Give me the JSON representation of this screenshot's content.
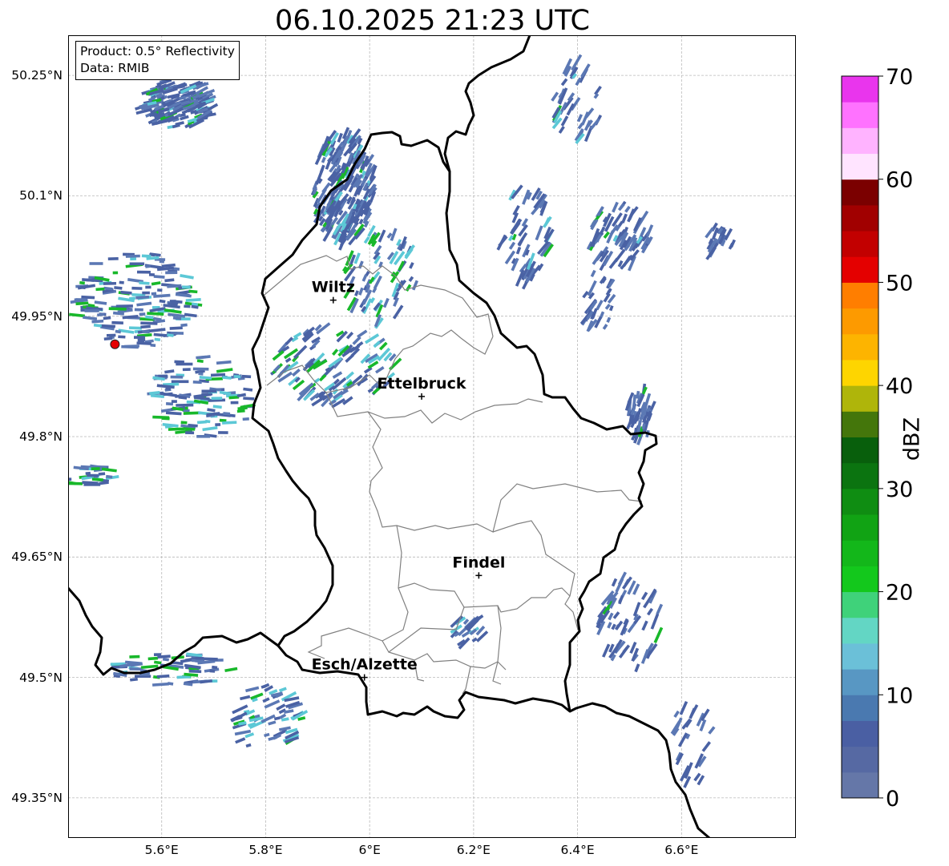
{
  "title": "06.10.2025 21:23 UTC",
  "info": {
    "product": "Product: 0.5° Reflectivity",
    "data": "Data: RMIB"
  },
  "map": {
    "lon_range": [
      5.42,
      6.82
    ],
    "lat_range": [
      49.3,
      50.3
    ],
    "gridlines": true,
    "lat_ticks": [
      {
        "value": 50.25,
        "label": "50.25°N"
      },
      {
        "value": 50.1,
        "label": "50.1°N"
      },
      {
        "value": 49.95,
        "label": "49.95°N"
      },
      {
        "value": 49.8,
        "label": "49.8°N"
      },
      {
        "value": 49.65,
        "label": "49.65°N"
      },
      {
        "value": 49.5,
        "label": "49.5°N"
      },
      {
        "value": 49.35,
        "label": "49.35°N"
      }
    ],
    "lon_ticks": [
      {
        "value": 5.6,
        "label": "5.6°E"
      },
      {
        "value": 5.8,
        "label": "5.8°E"
      },
      {
        "value": 6.0,
        "label": "6°E"
      },
      {
        "value": 6.2,
        "label": "6.2°E"
      },
      {
        "value": 6.4,
        "label": "6.4°E"
      },
      {
        "value": 6.6,
        "label": "6.6°E"
      }
    ],
    "cities": [
      {
        "name": "Wiltz",
        "lon": 5.93,
        "lat": 49.97
      },
      {
        "name": "Ettelbruck",
        "lon": 6.1,
        "lat": 49.85
      },
      {
        "name": "Findel",
        "lon": 6.21,
        "lat": 49.627
      },
      {
        "name": "Esch/Alzette",
        "lon": 5.99,
        "lat": 49.5
      }
    ],
    "radar_site": {
      "lon": 5.51,
      "lat": 49.915,
      "color": "#e60000"
    },
    "border_color": "#000000",
    "canton_color": "#808080"
  },
  "colorbar": {
    "label": "dBZ",
    "min": 0,
    "max": 70,
    "step": 2.5,
    "tick_labels": [
      "0",
      "10",
      "20",
      "30",
      "40",
      "50",
      "60",
      "70"
    ],
    "colors": [
      "#6577a8",
      "#5669a3",
      "#4a5fa3",
      "#4a79b0",
      "#5897c3",
      "#6bc0d8",
      "#63d6c4",
      "#3fd27a",
      "#13c81c",
      "#13b71a",
      "#11a314",
      "#0f8d12",
      "#0b7410",
      "#085f0c",
      "#44760b",
      "#afb50a",
      "#fed500",
      "#fdb400",
      "#fd9a00",
      "#ff7e00",
      "#e40000",
      "#c20000",
      "#a10000",
      "#7b0000",
      "#ffe4ff",
      "#ffb3ff",
      "#ff72ff",
      "#e935ed"
    ]
  },
  "echo_colors": {
    "weak": "#4a62a4",
    "light": "#5b78b4",
    "cyan": "#5cc8d6",
    "green": "#18b82a"
  },
  "echoes": [
    {
      "lon": 5.63,
      "lat": 50.215,
      "rx": 0.07,
      "ry": 0.03,
      "n": 160,
      "angle": -20,
      "level": "weak",
      "mix": 0.18
    },
    {
      "lon": 5.95,
      "lat": 50.11,
      "rx": 0.06,
      "ry": 0.07,
      "n": 220,
      "angle": -60,
      "level": "weak",
      "mix": 0.12
    },
    {
      "lon": 6.4,
      "lat": 50.22,
      "rx": 0.05,
      "ry": 0.05,
      "n": 40,
      "angle": -60,
      "level": "weak",
      "mix": 0.1
    },
    {
      "lon": 6.3,
      "lat": 50.05,
      "rx": 0.05,
      "ry": 0.06,
      "n": 55,
      "angle": -60,
      "level": "weak",
      "mix": 0.15
    },
    {
      "lon": 6.48,
      "lat": 50.05,
      "rx": 0.06,
      "ry": 0.04,
      "n": 75,
      "angle": -60,
      "level": "weak",
      "mix": 0.05
    },
    {
      "lon": 6.67,
      "lat": 50.045,
      "rx": 0.03,
      "ry": 0.02,
      "n": 20,
      "angle": -60,
      "level": "weak",
      "mix": 0.0
    },
    {
      "lon": 6.44,
      "lat": 49.97,
      "rx": 0.03,
      "ry": 0.04,
      "n": 30,
      "angle": -60,
      "level": "weak",
      "mix": 0.0
    },
    {
      "lon": 6.52,
      "lat": 49.83,
      "rx": 0.025,
      "ry": 0.035,
      "n": 45,
      "angle": -75,
      "level": "weak",
      "mix": 0.05
    },
    {
      "lon": 5.55,
      "lat": 49.97,
      "rx": 0.12,
      "ry": 0.06,
      "n": 160,
      "angle": 0,
      "level": "weak",
      "mix": 0.3
    },
    {
      "lon": 5.68,
      "lat": 49.85,
      "rx": 0.1,
      "ry": 0.05,
      "n": 110,
      "angle": 0,
      "level": "weak",
      "mix": 0.35
    },
    {
      "lon": 5.93,
      "lat": 49.89,
      "rx": 0.12,
      "ry": 0.05,
      "n": 110,
      "angle": -40,
      "level": "weak",
      "mix": 0.35
    },
    {
      "lon": 6.02,
      "lat": 50.0,
      "rx": 0.07,
      "ry": 0.06,
      "n": 70,
      "angle": -60,
      "level": "weak",
      "mix": 0.35
    },
    {
      "lon": 6.5,
      "lat": 49.57,
      "rx": 0.06,
      "ry": 0.06,
      "n": 60,
      "angle": -60,
      "level": "weak",
      "mix": 0.05
    },
    {
      "lon": 6.62,
      "lat": 49.42,
      "rx": 0.04,
      "ry": 0.06,
      "n": 25,
      "angle": -60,
      "level": "weak",
      "mix": 0.0
    },
    {
      "lon": 5.8,
      "lat": 49.45,
      "rx": 0.07,
      "ry": 0.04,
      "n": 60,
      "angle": -20,
      "level": "weak",
      "mix": 0.3
    },
    {
      "lon": 5.62,
      "lat": 49.51,
      "rx": 0.12,
      "ry": 0.02,
      "n": 60,
      "angle": 0,
      "level": "weak",
      "mix": 0.3
    },
    {
      "lon": 6.19,
      "lat": 49.56,
      "rx": 0.03,
      "ry": 0.02,
      "n": 20,
      "angle": -40,
      "level": "weak",
      "mix": 0.1
    },
    {
      "lon": 5.46,
      "lat": 49.75,
      "rx": 0.05,
      "ry": 0.015,
      "n": 25,
      "angle": 0,
      "level": "weak",
      "mix": 0.3
    }
  ]
}
